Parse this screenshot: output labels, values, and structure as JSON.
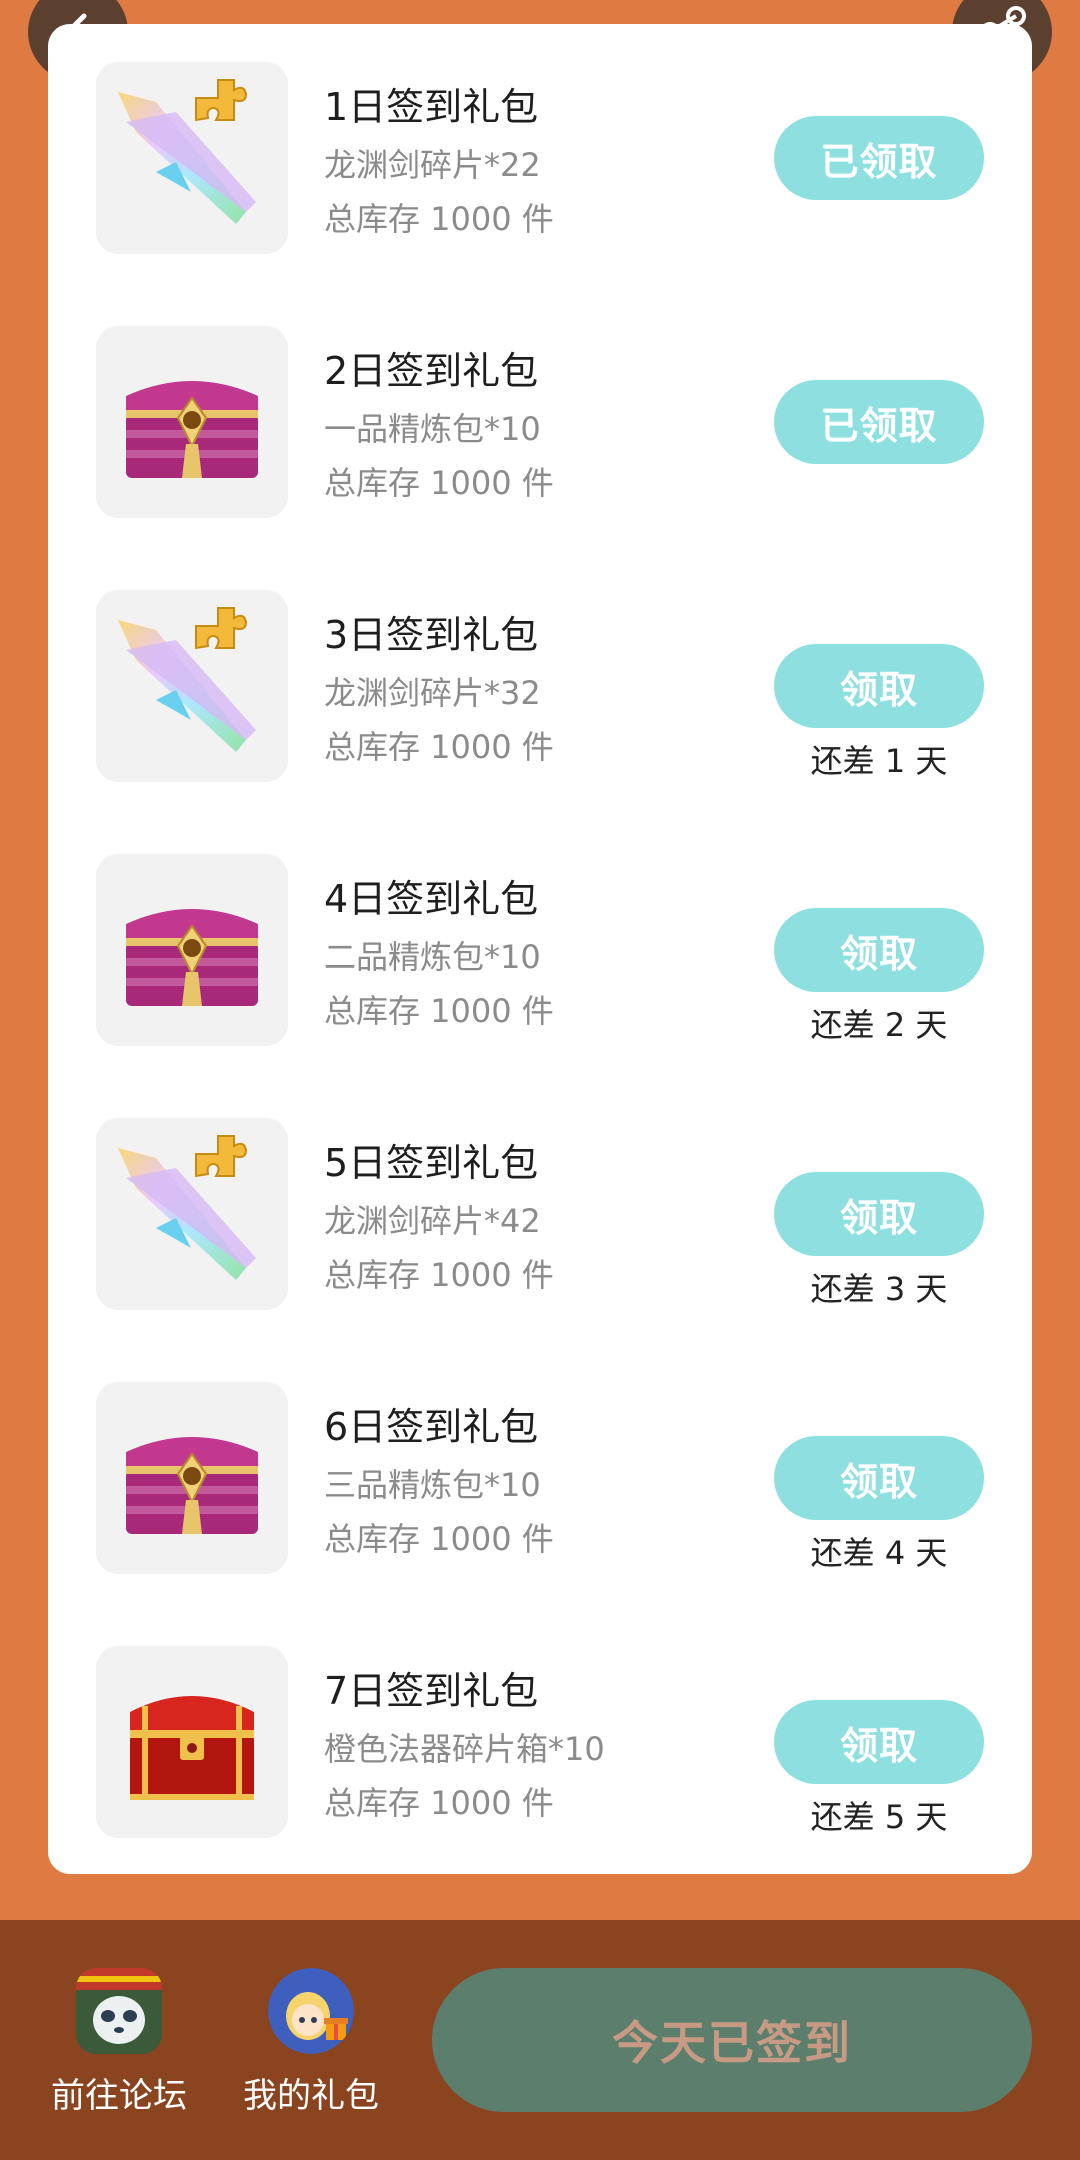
{
  "nav": {
    "back_icon": "chevron-left-icon",
    "share_icon": "share-icon"
  },
  "gifts": [
    {
      "title": "1日签到礼包",
      "desc": "龙渊剑碎片*22",
      "stock": "总库存 1000 件",
      "button": "已领取",
      "remaining": "",
      "image": "sword-fragment"
    },
    {
      "title": "2日签到礼包",
      "desc": "一品精炼包*10",
      "stock": "总库存 1000 件",
      "button": "已领取",
      "remaining": "",
      "image": "pink-chest"
    },
    {
      "title": "3日签到礼包",
      "desc": "龙渊剑碎片*32",
      "stock": "总库存 1000 件",
      "button": "领取",
      "remaining": "还差 1 天",
      "image": "sword-fragment"
    },
    {
      "title": "4日签到礼包",
      "desc": "二品精炼包*10",
      "stock": "总库存 1000 件",
      "button": "领取",
      "remaining": "还差 2 天",
      "image": "pink-chest"
    },
    {
      "title": "5日签到礼包",
      "desc": "龙渊剑碎片*42",
      "stock": "总库存 1000 件",
      "button": "领取",
      "remaining": "还差 3 天",
      "image": "sword-fragment"
    },
    {
      "title": "6日签到礼包",
      "desc": "三品精炼包*10",
      "stock": "总库存 1000 件",
      "button": "领取",
      "remaining": "还差 4 天",
      "image": "pink-chest"
    },
    {
      "title": "7日签到礼包",
      "desc": "橙色法器碎片箱*10",
      "stock": "总库存 1000 件",
      "button": "领取",
      "remaining": "还差 5 天",
      "image": "red-chest"
    }
  ],
  "bottom": {
    "forum_label": "前往论坛",
    "mygifts_label": "我的礼包",
    "checkin_label": "今天已签到"
  },
  "colors": {
    "background": "#de7a42",
    "claim_button": "#8ee0e0",
    "bottom_bar": "#8a4420",
    "checkin_button": "#5c7e6d",
    "checkin_text": "#c89a83"
  }
}
